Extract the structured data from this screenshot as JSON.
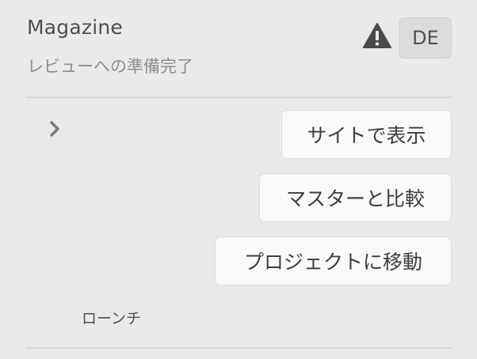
{
  "header": {
    "title": "Magazine",
    "status": "レビューへの準備完了",
    "language_badge": "DE",
    "warning_icon": "warning-icon"
  },
  "actions": {
    "view_on_site": "サイトで表示",
    "compare_to_master": "マスターと比較",
    "go_to_project": "プロジェクトに移動"
  },
  "section": {
    "expand_icon": "chevron-right-icon",
    "launch_label": "ローンチ"
  },
  "colors": {
    "background": "#eaeaea",
    "button_background": "#f9f9f9",
    "text": "#4b4b4b",
    "muted_text": "#8e8e8e"
  }
}
